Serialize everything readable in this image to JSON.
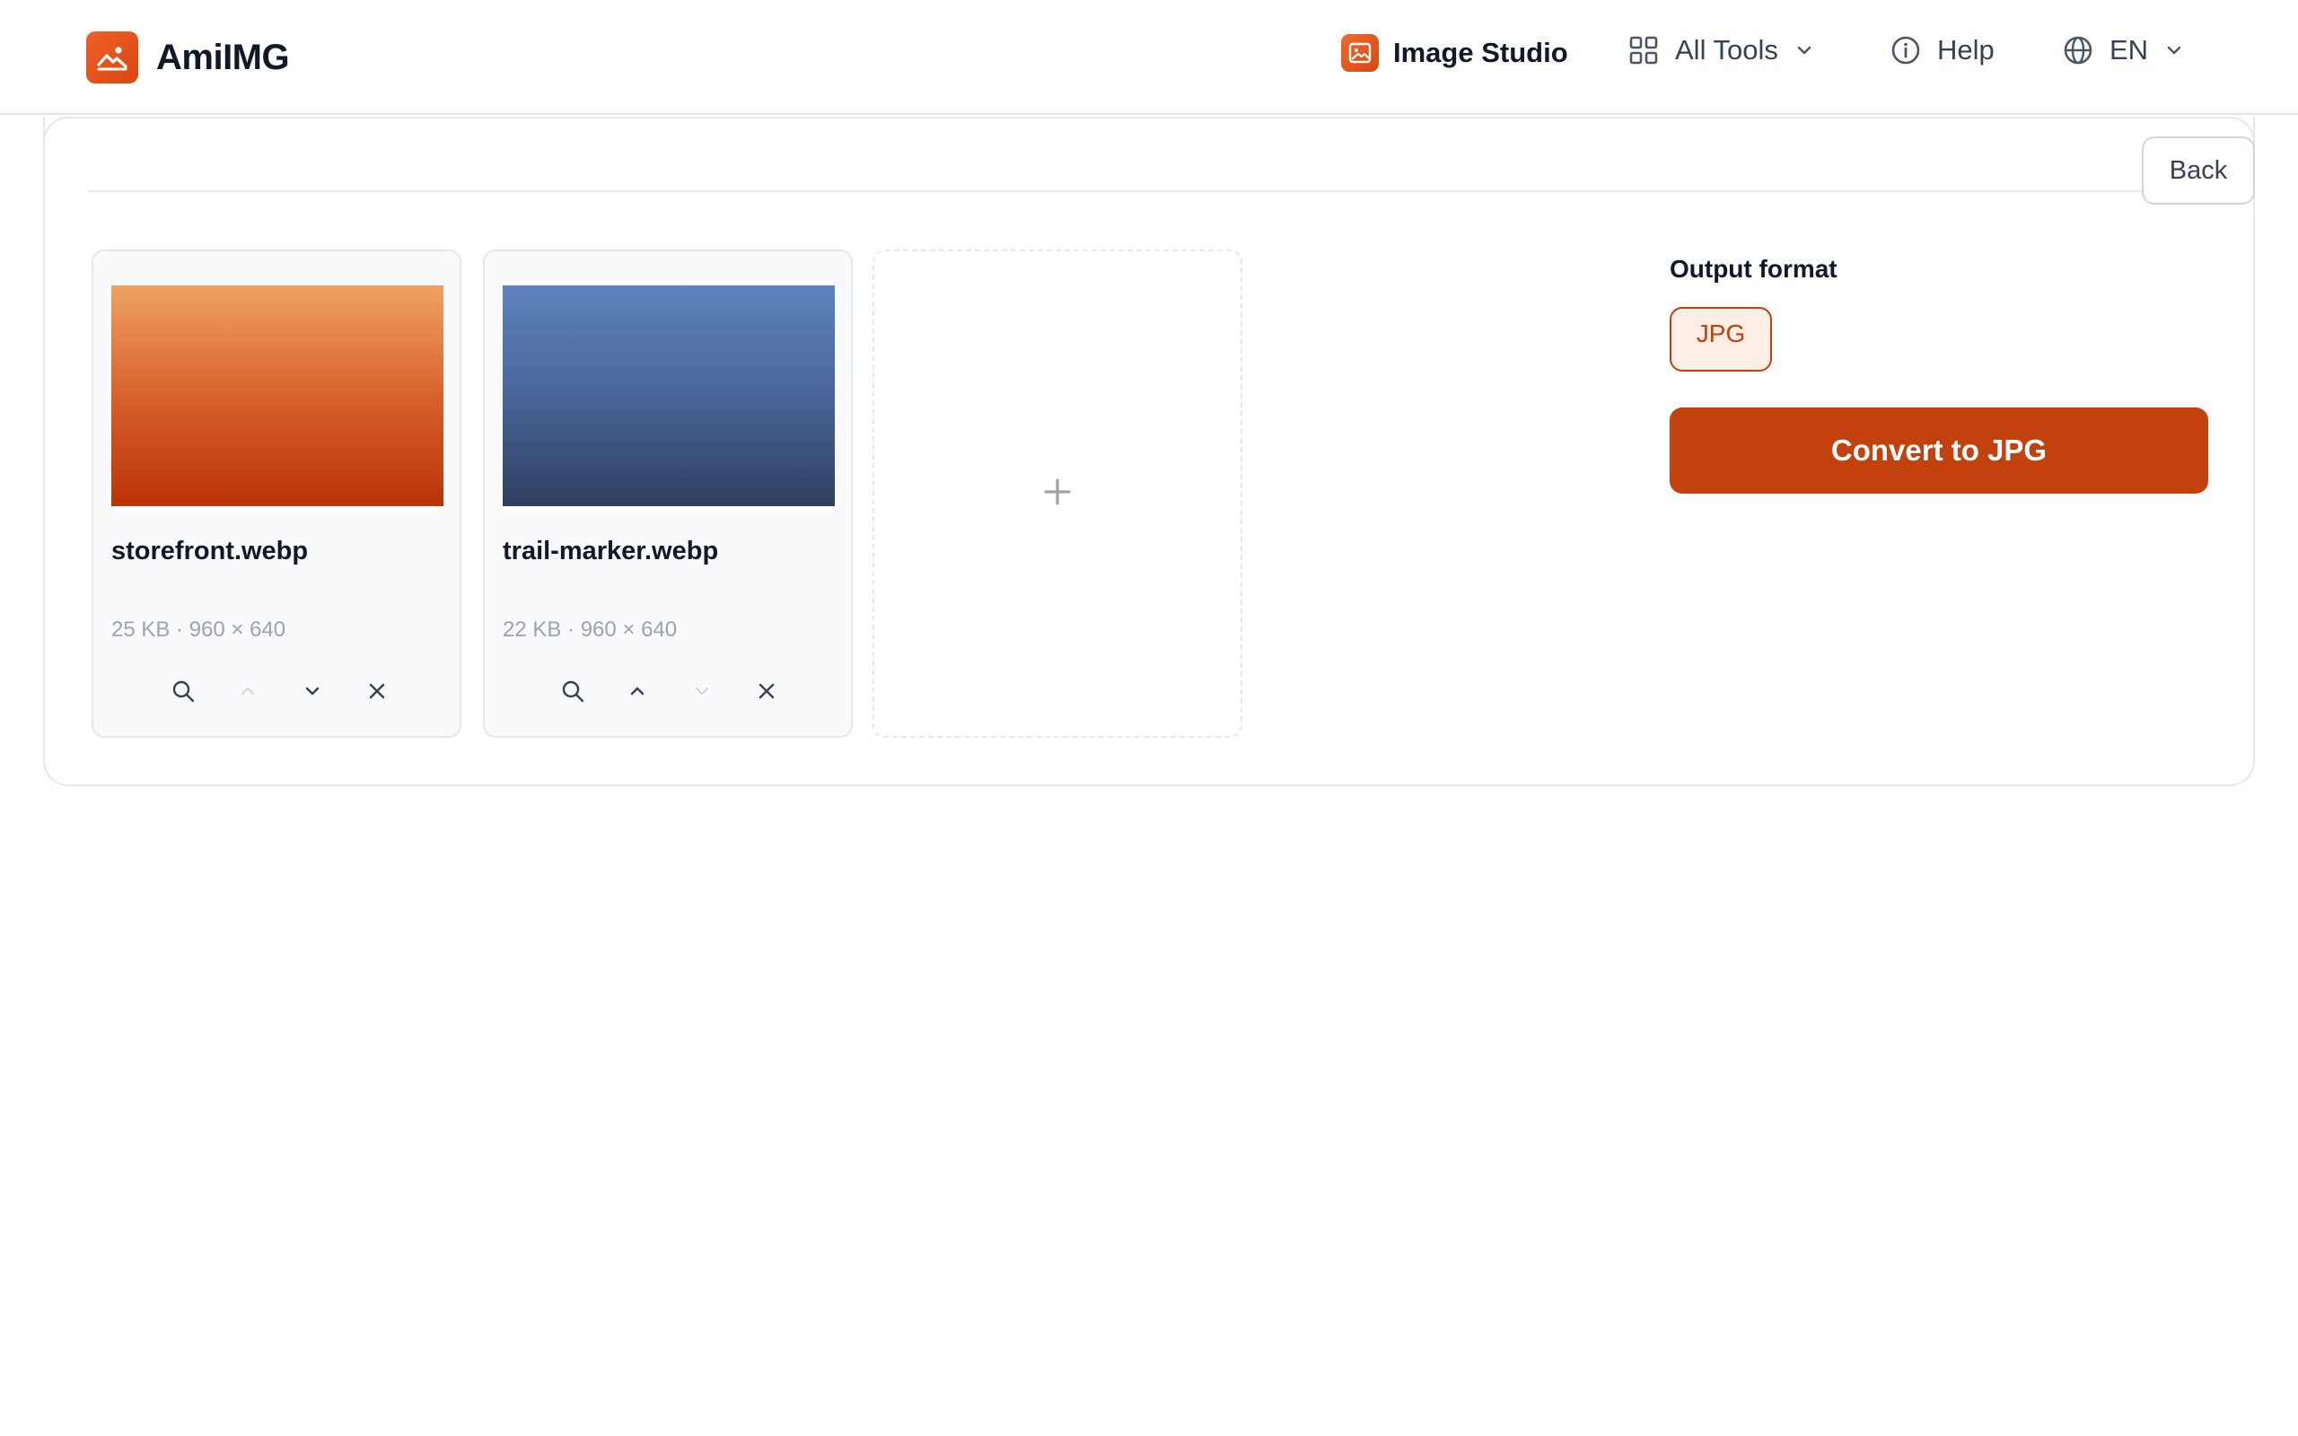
{
  "app": {
    "name": "AmiIMG"
  },
  "nav": {
    "studio_label": "Image Studio",
    "tools_label": "All Tools",
    "help_label": "Help",
    "lang_label": "EN"
  },
  "toolbar": {
    "back_label": "Back"
  },
  "files": [
    {
      "name": "storefront.webp",
      "meta": "25 KB · 960 × 640",
      "move_up_enabled": false,
      "move_down_enabled": true
    },
    {
      "name": "trail-marker.webp",
      "meta": "22 KB · 960 × 640",
      "move_up_enabled": true,
      "move_down_enabled": false
    }
  ],
  "add_tile": {
    "icon": "plus-icon"
  },
  "output": {
    "label": "Output format",
    "formats": [
      "JPG"
    ],
    "selected": "JPG",
    "convert_label": "Convert to JPG"
  },
  "colors": {
    "brand": "#e4531a",
    "accent": "#c2410c",
    "accent_bg": "#fdeee6",
    "border": "#e5e7eb",
    "muted_text": "#9ca3af"
  }
}
